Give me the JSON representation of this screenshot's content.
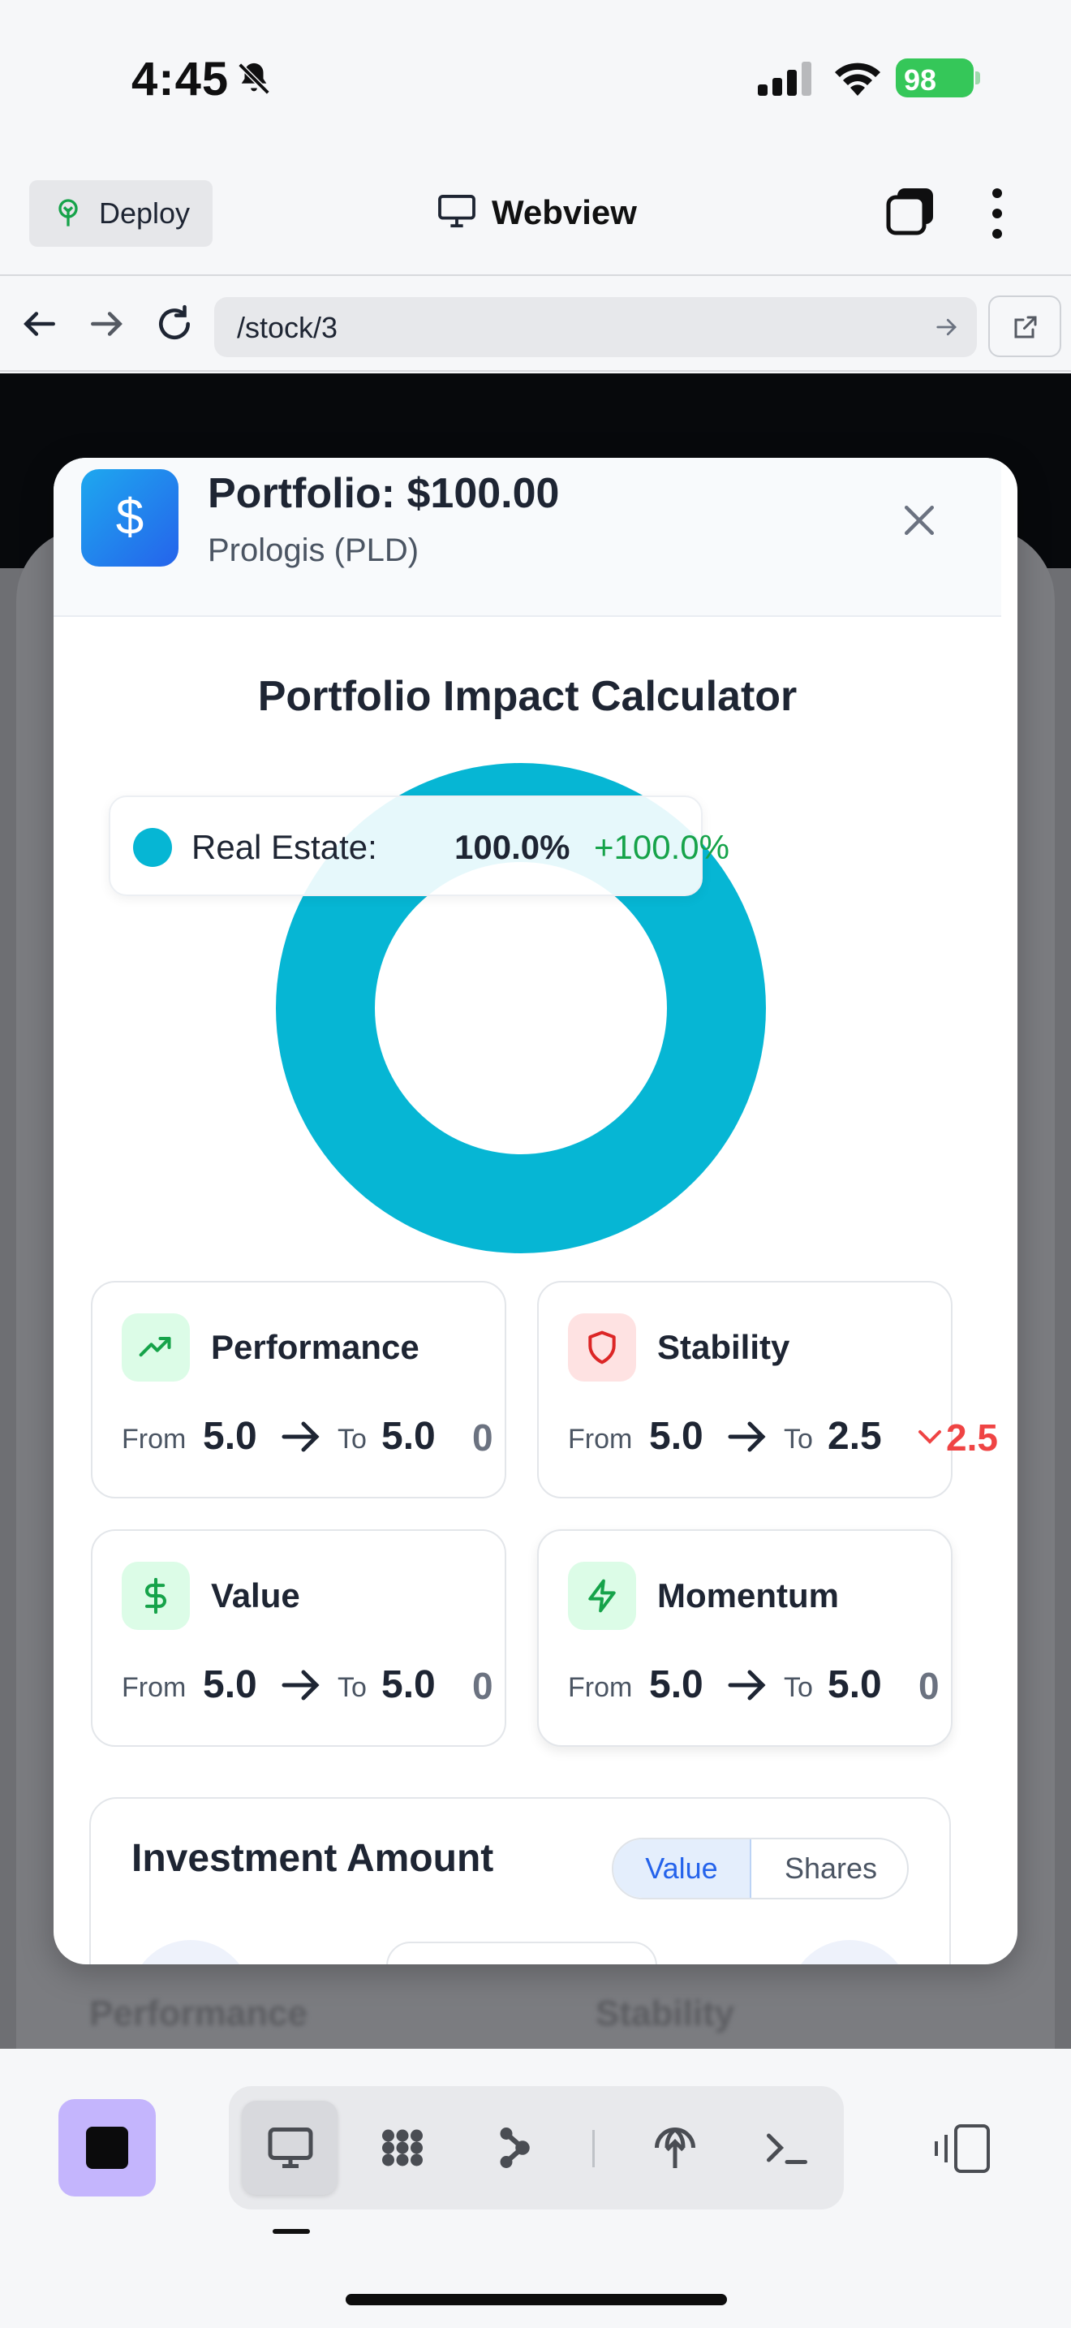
{
  "status_bar": {
    "time": "4:45",
    "battery": "98"
  },
  "webview": {
    "deploy_label": "Deploy",
    "title": "Webview"
  },
  "nav": {
    "url": "/stock/3"
  },
  "modal": {
    "title": "Portfolio: $100.00",
    "subtitle": "Prologis (PLD)",
    "logo_symbol": "$",
    "calculator_title": "Portfolio Impact Calculator"
  },
  "chart_data": {
    "type": "pie",
    "categories": [
      "Real Estate"
    ],
    "values": [
      100.0
    ],
    "colors": [
      "#06b6d4"
    ]
  },
  "tooltip": {
    "sector": "Real Estate:",
    "percent": "100.0%",
    "change": "+100.0%"
  },
  "metrics": [
    {
      "name": "Performance",
      "from_label": "From",
      "from": "5.0",
      "to_label": "To",
      "to": "5.0",
      "change": "0",
      "icon": "trending-up-icon",
      "accent": "#16a34a"
    },
    {
      "name": "Stability",
      "from_label": "From",
      "from": "5.0",
      "to_label": "To",
      "to": "2.5",
      "change": "2.5",
      "icon": "shield-icon",
      "accent": "#dc2626"
    },
    {
      "name": "Value",
      "from_label": "From",
      "from": "5.0",
      "to_label": "To",
      "to": "5.0",
      "change": "0",
      "icon": "dollar-icon",
      "accent": "#16a34a"
    },
    {
      "name": "Momentum",
      "from_label": "From",
      "from": "5.0",
      "to_label": "To",
      "to": "5.0",
      "change": "0",
      "icon": "zap-icon",
      "accent": "#16a34a"
    }
  ],
  "investment": {
    "title": "Investment Amount",
    "toggle_value": "Value",
    "toggle_shares": "Shares"
  },
  "backdrop": {
    "label_left": "Performance",
    "label_right": "Stability"
  }
}
